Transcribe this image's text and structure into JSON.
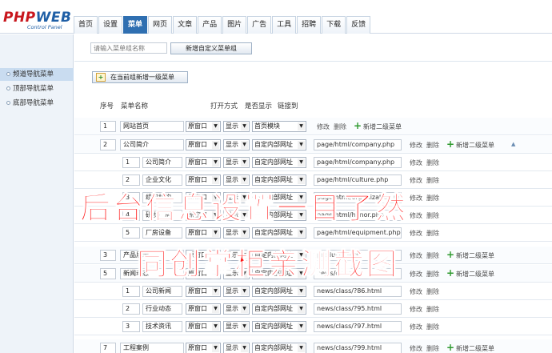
{
  "header": {
    "logo_main": "PHP",
    "logo_web": "WEB",
    "logo_sub": "Control Panel",
    "tabs": [
      {
        "label": "首页"
      },
      {
        "label": "设置"
      },
      {
        "label": "菜单",
        "active": true
      },
      {
        "label": "网页"
      },
      {
        "label": "文章"
      },
      {
        "label": "产品"
      },
      {
        "label": "图片"
      },
      {
        "label": "广告"
      },
      {
        "label": "工具"
      },
      {
        "label": "招聘"
      },
      {
        "label": "下载"
      },
      {
        "label": "反馈"
      }
    ]
  },
  "sidebar": {
    "items": [
      {
        "label": "频道导航菜单",
        "active": true
      },
      {
        "label": "顶部导航菜单"
      },
      {
        "label": "底部导航菜单"
      }
    ]
  },
  "toolbar": {
    "group_name_placeholder": "请输入菜单组名称",
    "new_group_label": "新增自定义菜单组",
    "add_top_label": "在当前组新增一级菜单"
  },
  "columns": {
    "order": "序号",
    "name": "菜单名称",
    "open_mode": "打开方式",
    "show": "是否显示",
    "link": "链接到"
  },
  "actions": {
    "edit": "修改",
    "delete": "删除",
    "add_sub": "新增二级菜单"
  },
  "rows": [
    {
      "level": 1,
      "order": "1",
      "name": "网站首页",
      "open": "原窗口",
      "show": "显示",
      "target": "首页模块",
      "url": ""
    },
    {
      "level": 1,
      "order": "2",
      "name": "公司简介",
      "open": "原窗口",
      "show": "显示",
      "target": "自定内部网址",
      "url": "page/html/company.php"
    },
    {
      "level": 2,
      "order": "1",
      "name": "公司简介",
      "open": "原窗口",
      "show": "显示",
      "target": "自定内部网址",
      "url": "page/html/company.php"
    },
    {
      "level": 2,
      "order": "2",
      "name": "企业文化",
      "open": "原窗口",
      "show": "显示",
      "target": "自定内部网址",
      "url": "page/html/culture.php"
    },
    {
      "level": 2,
      "order": "3",
      "name": "组织机构",
      "open": "原窗口",
      "show": "显示",
      "target": "自定内部网址",
      "url": "page/html/organization.php"
    },
    {
      "level": 2,
      "order": "4",
      "name": "研发厂房",
      "open": "原窗口",
      "show": "显示",
      "target": "自定内部网址",
      "url": "page/html/honor.php"
    },
    {
      "level": 2,
      "order": "5",
      "name": "厂房设备",
      "open": "原窗口",
      "show": "显示",
      "target": "自定内部网址",
      "url": "page/html/equipment.php"
    },
    {
      "level": 1,
      "order": "3",
      "name": "产品展示",
      "open": "原窗口",
      "show": "显示",
      "target": "自定内部网址",
      "url": "product/class/"
    },
    {
      "level": 1,
      "order": "5",
      "name": "新闻动态",
      "open": "原窗口",
      "show": "显示",
      "target": "自定内部网址",
      "url": "news/class/"
    },
    {
      "level": 2,
      "order": "1",
      "name": "公司新闻",
      "open": "原窗口",
      "show": "显示",
      "target": "自定内部网址",
      "url": "news/class/?86.html"
    },
    {
      "level": 2,
      "order": "2",
      "name": "行业动态",
      "open": "原窗口",
      "show": "显示",
      "target": "自定内部网址",
      "url": "news/class/?95.html"
    },
    {
      "level": 2,
      "order": "3",
      "name": "技术资讯",
      "open": "原窗口",
      "show": "显示",
      "target": "自定内部网址",
      "url": "news/class/?97.html"
    },
    {
      "level": 1,
      "order": "7",
      "name": "工程案例",
      "open": "原窗口",
      "show": "显示",
      "target": "自定内部网址",
      "url": "news/class/?99.html"
    }
  ],
  "overlay": {
    "line1": "后台信息设置一目了然",
    "line2": "同创掌柜亲测截图"
  }
}
